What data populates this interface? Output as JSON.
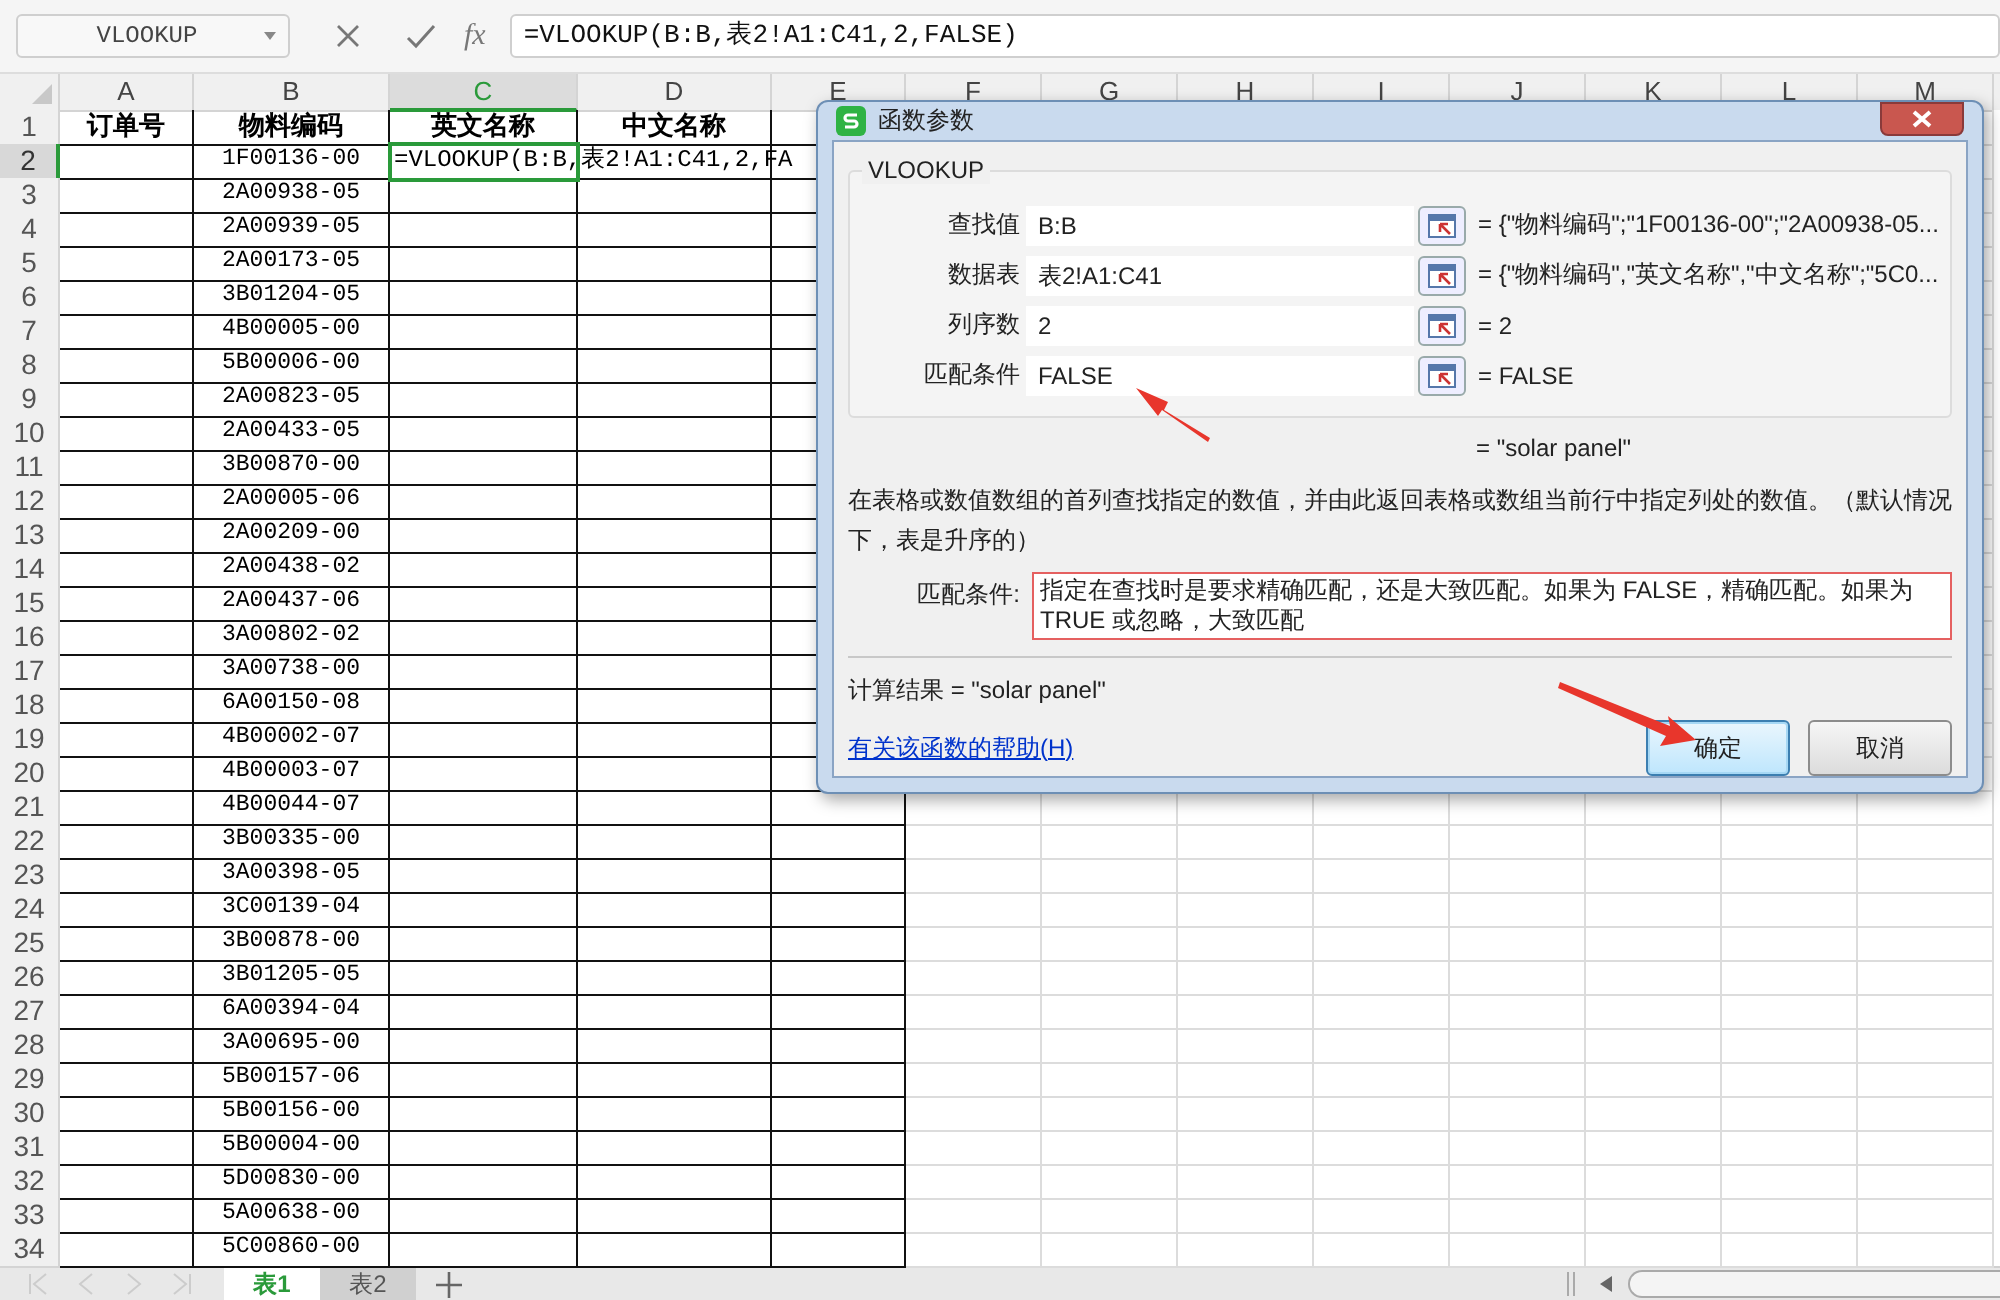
{
  "name_box": {
    "value": "VLOOKUP"
  },
  "formula_bar": {
    "fx": "fx",
    "value": "=VLOOKUP(B:B,表2!A1:C41,2,FALSE)"
  },
  "columns": [
    {
      "label": "A",
      "selected": false
    },
    {
      "label": "B",
      "selected": false
    },
    {
      "label": "C",
      "selected": true
    },
    {
      "label": "D",
      "selected": false
    },
    {
      "label": "E",
      "selected": false
    },
    {
      "label": "F",
      "selected": false
    },
    {
      "label": "G",
      "selected": false
    },
    {
      "label": "H",
      "selected": false
    },
    {
      "label": "I",
      "selected": false
    },
    {
      "label": "J",
      "selected": false
    },
    {
      "label": "K",
      "selected": false
    },
    {
      "label": "L",
      "selected": false
    },
    {
      "label": "M",
      "selected": false
    }
  ],
  "header_row": {
    "number": "1",
    "cells": [
      "订单号",
      "物料编码",
      "英文名称",
      "中文名称"
    ]
  },
  "rows": [
    {
      "number": "2",
      "code": "1F00136-00",
      "selected": true,
      "editing": "=VLOOKUP(B:B,表2!A1:C41,2,FA"
    },
    {
      "number": "3",
      "code": "2A00938-05",
      "selected": false
    },
    {
      "number": "4",
      "code": "2A00939-05",
      "selected": false
    },
    {
      "number": "5",
      "code": "2A00173-05",
      "selected": false
    },
    {
      "number": "6",
      "code": "3B01204-05",
      "selected": false
    },
    {
      "number": "7",
      "code": "4B00005-00",
      "selected": false
    },
    {
      "number": "8",
      "code": "5B00006-00",
      "selected": false
    },
    {
      "number": "9",
      "code": "2A00823-05",
      "selected": false
    },
    {
      "number": "10",
      "code": "2A00433-05",
      "selected": false
    },
    {
      "number": "11",
      "code": "3B00870-00",
      "selected": false
    },
    {
      "number": "12",
      "code": "2A00005-06",
      "selected": false
    },
    {
      "number": "13",
      "code": "2A00209-00",
      "selected": false
    },
    {
      "number": "14",
      "code": "2A00438-02",
      "selected": false
    },
    {
      "number": "15",
      "code": "2A00437-06",
      "selected": false
    },
    {
      "number": "16",
      "code": "3A00802-02",
      "selected": false
    },
    {
      "number": "17",
      "code": "3A00738-00",
      "selected": false
    },
    {
      "number": "18",
      "code": "6A00150-08",
      "selected": false
    },
    {
      "number": "19",
      "code": "4B00002-07",
      "selected": false
    },
    {
      "number": "20",
      "code": "4B00003-07",
      "selected": false
    },
    {
      "number": "21",
      "code": "4B00044-07",
      "selected": false
    },
    {
      "number": "22",
      "code": "3B00335-00",
      "selected": false
    },
    {
      "number": "23",
      "code": "3A00398-05",
      "selected": false
    },
    {
      "number": "24",
      "code": "3C00139-04",
      "selected": false
    },
    {
      "number": "25",
      "code": "3B00878-00",
      "selected": false
    },
    {
      "number": "26",
      "code": "3B01205-05",
      "selected": false
    },
    {
      "number": "27",
      "code": "6A00394-04",
      "selected": false
    },
    {
      "number": "28",
      "code": "3A00695-00",
      "selected": false
    },
    {
      "number": "29",
      "code": "5B00157-06",
      "selected": false
    },
    {
      "number": "30",
      "code": "5B00156-00",
      "selected": false
    },
    {
      "number": "31",
      "code": "5B00004-00",
      "selected": false
    },
    {
      "number": "32",
      "code": "5D00830-00",
      "selected": false
    },
    {
      "number": "33",
      "code": "5A00638-00",
      "selected": false
    },
    {
      "number": "34",
      "code": "5C00860-00",
      "selected": false
    }
  ],
  "sheet_tabs": [
    {
      "label": "表1",
      "selected": true
    },
    {
      "label": "表2",
      "selected": false
    }
  ],
  "dialog": {
    "title": "函数参数",
    "function_name": "VLOOKUP",
    "arguments": [
      {
        "label": "查找值",
        "value": "B:B",
        "result": "= {\"物料编码\";\"1F00136-00\";\"2A00938-05..."
      },
      {
        "label": "数据表",
        "value": "表2!A1:C41",
        "result": "= {\"物料编码\",\"英文名称\",\"中文名称\";\"5C0..."
      },
      {
        "label": "列序数",
        "value": "2",
        "result": "= 2"
      },
      {
        "label": "匹配条件",
        "value": "FALSE",
        "result": "= FALSE"
      }
    ],
    "preview": "=  \"solar panel\"",
    "description": "在表格或数值数组的首列查找指定的数值，并由此返回表格或数组当前行中指定列处的数值。（默认情况下，表是升序的）",
    "argument_help": {
      "label": "匹配条件:",
      "text": "指定在查找时是要求精确匹配，还是大致匹配。如果为 FALSE，精确匹配。如果为 TRUE 或忽略，大致匹配"
    },
    "calc_result": "计算结果 =  \"solar panel\"",
    "help_link": "有关该函数的帮助(H)",
    "buttons": [
      {
        "label": "确定",
        "kind": "primary"
      },
      {
        "label": "取消",
        "kind": "secondary"
      }
    ]
  }
}
